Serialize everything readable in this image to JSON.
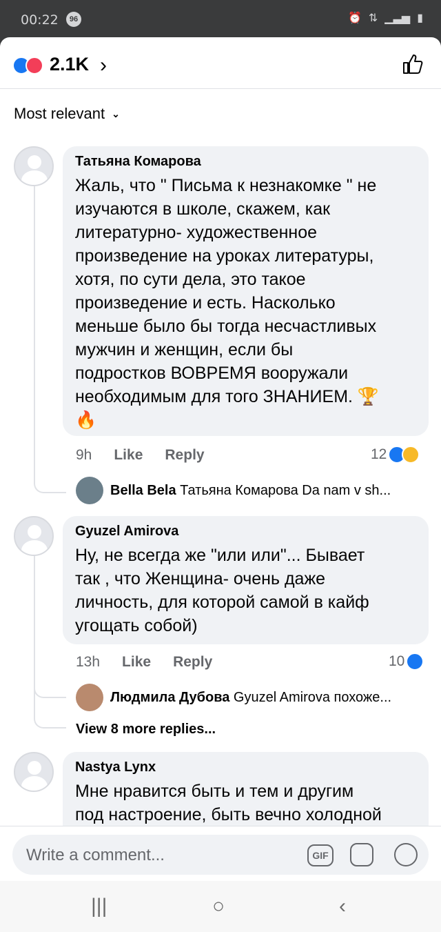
{
  "status_bar": {
    "time": "00:22",
    "notif_count": "96"
  },
  "header": {
    "reaction_count": "2.1K"
  },
  "sort": {
    "label": "Most relevant"
  },
  "comments": [
    {
      "author": "Татьяна Комарова",
      "text": "Жаль, что \" Письма к незнакомке \" не\nизучаются в школе, скажем, как\nлитературно- художественное\nпроизведение на уроках литературы,\nхотя,  по сути дела, это такое\nпроизведение и есть. Насколько\nменьше было бы тогда несчастливых\nмужчин и женщин, если бы\nподростков ВОВРЕМЯ вооружали\nнеобходимым для того ЗНАНИЕМ. 🏆\n🔥",
      "time": "9h",
      "like": "Like",
      "reply": "Reply",
      "reactions": "12",
      "reply_preview": {
        "author": "Bella Bela",
        "text": "Татьяна Комарова Da nam v sh..."
      }
    },
    {
      "author": "Gyuzel Amirova",
      "text": "Ну, не всегда же \"или или\"... Бывает\nтак , что Женщина- очень даже\nличность, для которой самой в кайф\nугощать собой)",
      "time": "13h",
      "like": "Like",
      "reply": "Reply",
      "reactions": "10",
      "reply_preview": {
        "author": "Людмила Дубова",
        "text": "Gyuzel Amirova похоже..."
      },
      "more_replies": "View 8 more replies..."
    },
    {
      "author": "Nastya Lynx",
      "text": "Мне нравится быть и тем и другим\nпод настроение, быть вечно холодной"
    }
  ],
  "composer": {
    "placeholder": "Write a comment...",
    "gif_label": "GIF"
  },
  "colors": {
    "like_blue": "#1877f2",
    "love_red": "#f33e58",
    "bubble_bg": "#f0f2f5"
  }
}
